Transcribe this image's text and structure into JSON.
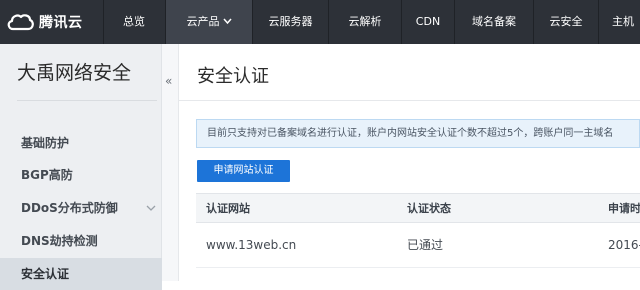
{
  "brand": {
    "name": "腾讯云",
    "logo_icon": "cloud-logo-icon"
  },
  "nav": {
    "items": [
      {
        "label": "总览",
        "has_chevron": false
      },
      {
        "label": "云产品",
        "has_chevron": true
      },
      {
        "label": "云服务器",
        "has_chevron": false
      },
      {
        "label": "云解析",
        "has_chevron": false
      },
      {
        "label": "CDN",
        "has_chevron": false
      },
      {
        "label": "域名备案",
        "has_chevron": false
      },
      {
        "label": "云安全",
        "has_chevron": false
      },
      {
        "label": "主机",
        "has_chevron": false
      }
    ]
  },
  "sidebar": {
    "title": "大禹网络安全",
    "collapse_symbol": "«",
    "items": [
      {
        "label": "基础防护",
        "active": false,
        "has_chevron": false
      },
      {
        "label": "BGP高防",
        "active": false,
        "has_chevron": false
      },
      {
        "label": "DDoS分布式防御",
        "active": false,
        "has_chevron": true
      },
      {
        "label": "DNS劫持检测",
        "active": false,
        "has_chevron": false
      },
      {
        "label": "安全认证",
        "active": true,
        "has_chevron": false
      }
    ]
  },
  "main": {
    "title": "安全认证",
    "notice": "目前只支持对已备案域名进行认证，账户内网站安全认证个数不超过5个，跨账户同一主域名",
    "apply_button": "申请网站认证",
    "table": {
      "headers": [
        "认证网站",
        "认证状态",
        "申请时"
      ],
      "rows": [
        [
          "www.13web.cn",
          "已通过",
          "2016-"
        ]
      ]
    }
  },
  "colors": {
    "nav_bg": "#2d3138",
    "sidebar_bg": "#edeff2",
    "primary_button": "#1d74d8",
    "notice_bg": "#e8f2fb"
  }
}
